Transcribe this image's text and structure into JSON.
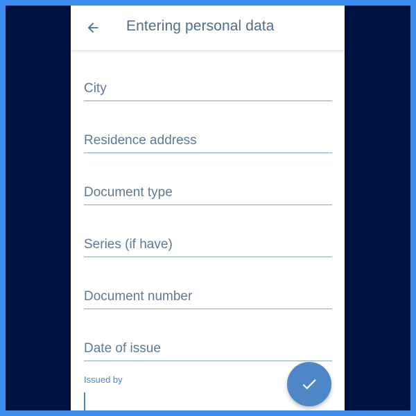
{
  "screen": {
    "title": "Entering personal data"
  },
  "form": {
    "fields": [
      {
        "label": "City"
      },
      {
        "label": "Residence address"
      },
      {
        "label": "Document type"
      },
      {
        "label": "Series (if have)"
      },
      {
        "label": "Document number"
      },
      {
        "label": "Date of issue"
      }
    ],
    "issued_by": {
      "label": "Issued by",
      "value": ""
    }
  },
  "icons": {
    "back": "arrow-back-icon",
    "confirm": "check-icon"
  },
  "colors": {
    "frame_border": "#3a8ef0",
    "outer_background": "#001040",
    "accent": "#4f86c6",
    "title_text": "#4e6e8a",
    "field_text": "#5c7a96",
    "field_underline": "#8aa5b8"
  }
}
